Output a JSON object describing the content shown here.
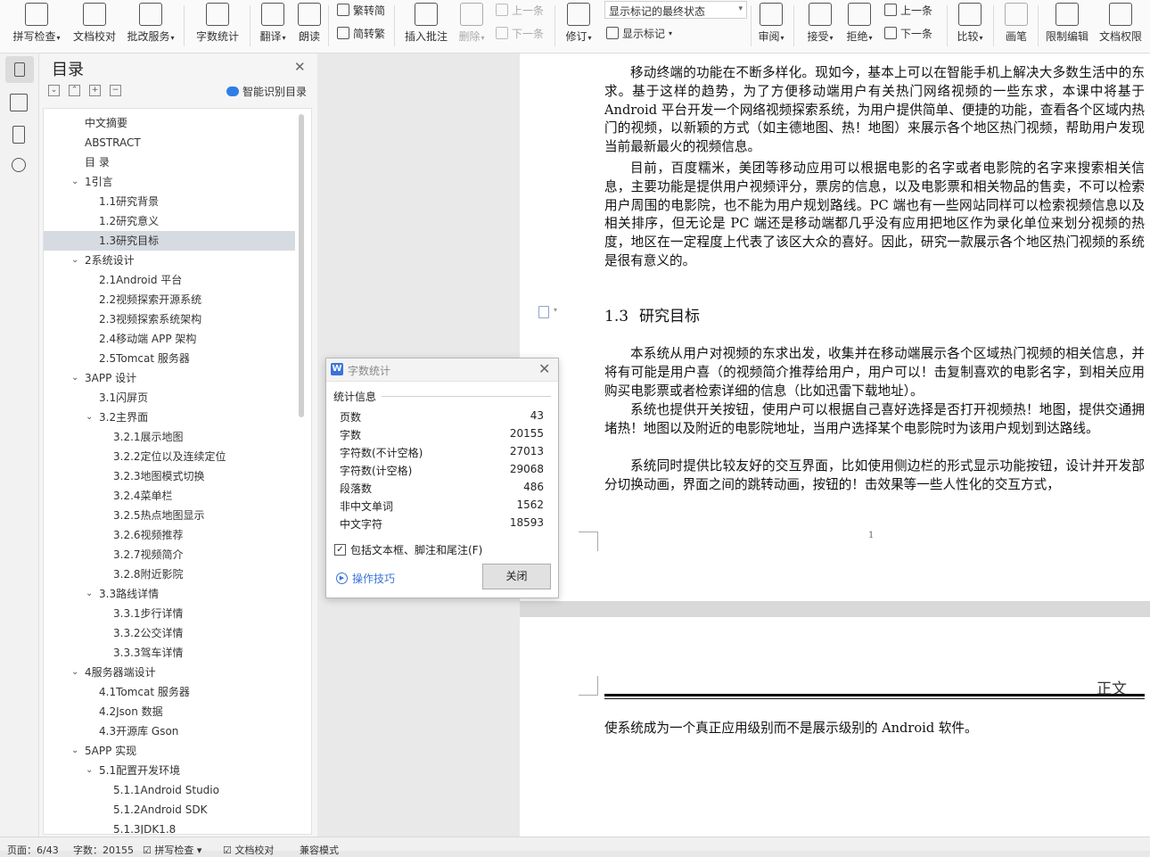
{
  "ribbon": {
    "spell_check": "拼写检查",
    "doc_proofread": "文档校对",
    "batch_revise": "批改服务",
    "word_count": "字数统计",
    "translate": "翻译",
    "read_aloud": "朗读",
    "trad_conv": "繁转简",
    "simp_conv": "简转繁",
    "insert_comment": "插入批注",
    "delete": "删除",
    "prev_comment": "上一条",
    "next_comment": "下一条",
    "revise": "修订",
    "markup_state": "显示标记的最终状态",
    "show_markup": "显示标记",
    "review": "审阅",
    "accept": "接受",
    "reject": "拒绝",
    "prev_change": "上一条",
    "next_change": "下一条",
    "compare": "比较",
    "pen": "画笔",
    "restrict_edit": "限制编辑",
    "doc_rights": "文档权限"
  },
  "toc": {
    "title": "目录",
    "smart_label": "智能识别目录",
    "items": [
      {
        "label": "中文摘要",
        "level": 1,
        "expand": false
      },
      {
        "label": "ABSTRACT",
        "level": 1,
        "expand": false
      },
      {
        "label": "目 录",
        "level": 1,
        "expand": false
      },
      {
        "label": "1引言",
        "level": 1,
        "expand": true
      },
      {
        "label": "1.1研究背景",
        "level": 2,
        "expand": false
      },
      {
        "label": "1.2研究意义",
        "level": 2,
        "expand": false
      },
      {
        "label": "1.3研究目标",
        "level": 2,
        "expand": false,
        "selected": true
      },
      {
        "label": "2系统设计",
        "level": 1,
        "expand": true
      },
      {
        "label": "2.1Android 平台",
        "level": 2,
        "expand": false
      },
      {
        "label": "2.2视频探索开源系统",
        "level": 2,
        "expand": false
      },
      {
        "label": "2.3视频探索系统架构",
        "level": 2,
        "expand": false
      },
      {
        "label": "2.4移动端 APP 架构",
        "level": 2,
        "expand": false
      },
      {
        "label": "2.5Tomcat 服务器",
        "level": 2,
        "expand": false
      },
      {
        "label": "3APP 设计",
        "level": 1,
        "expand": true
      },
      {
        "label": "3.1闪屏页",
        "level": 2,
        "expand": false
      },
      {
        "label": "3.2主界面",
        "level": 2,
        "expand": true
      },
      {
        "label": "3.2.1展示地图",
        "level": 3,
        "expand": false
      },
      {
        "label": "3.2.2定位以及连续定位",
        "level": 3,
        "expand": false
      },
      {
        "label": "3.2.3地图模式切换",
        "level": 3,
        "expand": false
      },
      {
        "label": "3.2.4菜单栏",
        "level": 3,
        "expand": false
      },
      {
        "label": "3.2.5热点地图显示",
        "level": 3,
        "expand": false
      },
      {
        "label": "3.2.6视频推荐",
        "level": 3,
        "expand": false
      },
      {
        "label": "3.2.7视频简介",
        "level": 3,
        "expand": false
      },
      {
        "label": "3.2.8附近影院",
        "level": 3,
        "expand": false
      },
      {
        "label": "3.3路线详情",
        "level": 2,
        "expand": true
      },
      {
        "label": "3.3.1步行详情",
        "level": 3,
        "expand": false
      },
      {
        "label": "3.3.2公交详情",
        "level": 3,
        "expand": false
      },
      {
        "label": "3.3.3驾车详情",
        "level": 3,
        "expand": false
      },
      {
        "label": "4服务器端设计",
        "level": 1,
        "expand": true
      },
      {
        "label": "4.1Tomcat 服务器",
        "level": 2,
        "expand": false
      },
      {
        "label": "4.2Json 数据",
        "level": 2,
        "expand": false
      },
      {
        "label": "4.3开源库 Gson",
        "level": 2,
        "expand": false
      },
      {
        "label": "5APP 实现",
        "level": 1,
        "expand": true
      },
      {
        "label": "5.1配置开发环境",
        "level": 2,
        "expand": true
      },
      {
        "label": "5.1.1Android Studio",
        "level": 3,
        "expand": false
      },
      {
        "label": "5.1.2Android SDK",
        "level": 3,
        "expand": false
      },
      {
        "label": "5.1.3JDK1.8",
        "level": 3,
        "expand": false
      }
    ]
  },
  "doc": {
    "para1": "移动终端的功能在不断多样化。现如今，基本上可以在智能手机上解决大多数生活中的东求。基于这样的趋势，为了方便移动端用户有关热门网络视频的一些东求，本课中将基于 Android 平台开发一个网络视频探索系统，为用户提供简单、便捷的功能，查看各个区域内热门的视频，以新颖的方式（如主德地图、热！地图）来展示各个地区热门视频，帮助用户发现当前最新最火的视频信息。",
    "para2": "目前，百度糯米，美团等移动应用可以根据电影的名字或者电影院的名字来搜索相关信息，主要功能是提供用户视频评分，票房的信息，以及电影票和相关物品的售卖，不可以检索用户周围的电影院，也不能为用户规划路线。PC 端也有一些网站同样可以检索视频信息以及相关排序，但无论是 PC 端还是移动端都几乎没有应用把地区作为录化单位来划分视频的热度，地区在一定程度上代表了该区大众的喜好。因此，研究一款展示各个地区热门视频的系统是很有意义的。",
    "heading_num": "1.3",
    "heading_text": "研究目标",
    "para3": "本系统从用户对视频的东求出发，收集并在移动端展示各个区域热门视频的相关信息，并将有可能是用户喜（的视频简介推荐给用户，用户可以！击复制喜欢的电影名字，到相关应用购买电影票或者检索详细的信息（比如迅雷下载地址）。",
    "para4": "系统也提供开关按钮，使用户可以根据自己喜好选择是否打开视频热！地图，提供交通拥堵热！地图以及附近的电影院地址，当用户选择某个电影院时为该用户规划到达路线。",
    "para5": "系统同时提供比较友好的交互界面，比如使用侧边栏的形式显示功能按钮，设计并开发部分切换动画，界面之间的跳转动画，按钮的！击效果等一些人性化的交互方式，",
    "page_number": "1",
    "header_label": "正文",
    "page2_text": "使系统成为一个真正应用级别而不是展示级别的  Android 软件。"
  },
  "dialog": {
    "title": "字数统计",
    "section": "统计信息",
    "rows": [
      {
        "k": "页数",
        "v": "43"
      },
      {
        "k": "字数",
        "v": "20155"
      },
      {
        "k": "字符数(不计空格)",
        "v": "27013"
      },
      {
        "k": "字符数(计空格)",
        "v": "29068"
      },
      {
        "k": "段落数",
        "v": "486"
      },
      {
        "k": "非中文单词",
        "v": "1562"
      },
      {
        "k": "中文字符",
        "v": "18593"
      }
    ],
    "checkbox_label": "包括文本框、脚注和尾注(F)",
    "checkbox_checked": true,
    "tips_link": "操作技巧",
    "close_btn": "关闭"
  },
  "status": {
    "page": "页面：6/43",
    "words": "字数：20155",
    "spell": "拼写检查",
    "proof": "文档校对",
    "mode": "兼容模式"
  }
}
